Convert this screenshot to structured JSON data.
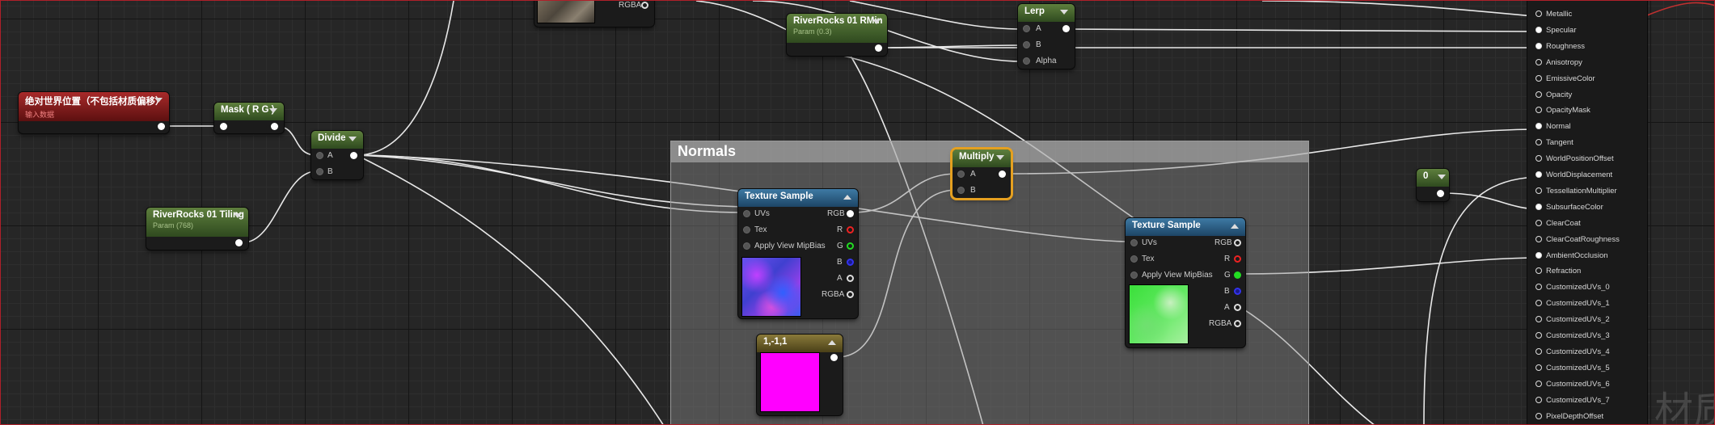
{
  "comment": {
    "title": "Normals"
  },
  "nodes": {
    "world_pos": {
      "title": "绝对世界位置（不包括材质偏移）",
      "subtitle": "输入数据"
    },
    "mask": {
      "title": "Mask ( R G )"
    },
    "divide": {
      "title": "Divide",
      "pins": [
        "A",
        "B"
      ]
    },
    "tiling": {
      "title": "RiverRocks 01 Tiling",
      "subtitle": "Param (768)"
    },
    "rmin": {
      "title": "RiverRocks 01 RMin",
      "subtitle": "Param (0.3)"
    },
    "lerp": {
      "title": "Lerp",
      "pins": [
        "A",
        "B",
        "Alpha"
      ]
    },
    "multiply": {
      "title": "Multiply",
      "pins": [
        "A",
        "B"
      ]
    },
    "tex_top": {
      "out_label": "RGBA"
    },
    "tex_normal": {
      "title": "Texture Sample",
      "inputs": [
        "UVs",
        "Tex",
        "Apply View MipBias"
      ],
      "outputs": [
        "RGB",
        "R",
        "G",
        "B",
        "A",
        "RGBA"
      ]
    },
    "tex_ao": {
      "title": "Texture Sample",
      "inputs": [
        "UVs",
        "Tex",
        "Apply View MipBias"
      ],
      "outputs": [
        "RGB",
        "R",
        "G",
        "B",
        "A",
        "RGBA"
      ]
    },
    "vec": {
      "title": "1,-1,1"
    },
    "zero": {
      "title": "0"
    }
  },
  "result_pins": [
    {
      "label": "Metallic",
      "connected": false
    },
    {
      "label": "Specular",
      "connected": true
    },
    {
      "label": "Roughness",
      "connected": true
    },
    {
      "label": "Anisotropy",
      "connected": false
    },
    {
      "label": "EmissiveColor",
      "connected": false
    },
    {
      "label": "Opacity",
      "connected": false
    },
    {
      "label": "OpacityMask",
      "connected": false
    },
    {
      "label": "Normal",
      "connected": true
    },
    {
      "label": "Tangent",
      "connected": false
    },
    {
      "label": "WorldPositionOffset",
      "connected": false
    },
    {
      "label": "WorldDisplacement",
      "connected": true
    },
    {
      "label": "TessellationMultiplier",
      "connected": false
    },
    {
      "label": "SubsurfaceColor",
      "connected": true
    },
    {
      "label": "ClearCoat",
      "connected": false
    },
    {
      "label": "ClearCoatRoughness",
      "connected": false
    },
    {
      "label": "AmbientOcclusion",
      "connected": true
    },
    {
      "label": "Refraction",
      "connected": false
    },
    {
      "label": "CustomizedUVs_0",
      "connected": false
    },
    {
      "label": "CustomizedUVs_1",
      "connected": false
    },
    {
      "label": "CustomizedUVs_2",
      "connected": false
    },
    {
      "label": "CustomizedUVs_3",
      "connected": false
    },
    {
      "label": "CustomizedUVs_4",
      "connected": false
    },
    {
      "label": "CustomizedUVs_5",
      "connected": false
    },
    {
      "label": "CustomizedUVs_6",
      "connected": false
    },
    {
      "label": "CustomizedUVs_7",
      "connected": false
    },
    {
      "label": "PixelDepthOffset",
      "connected": false
    }
  ],
  "watermark": "材质",
  "colors": {
    "selection": "#e5a020",
    "param_header": "#5e7f3d",
    "input_header": "#a82a2a",
    "texture_header": "#3e7aa4",
    "vector_swatch": "#ff00ff"
  }
}
